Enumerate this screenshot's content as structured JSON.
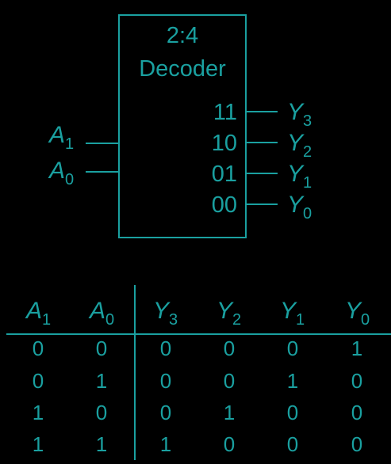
{
  "decoder": {
    "title_line1": "2:4",
    "title_line2": "Decoder",
    "inputs": [
      {
        "var": "A",
        "sub": "1"
      },
      {
        "var": "A",
        "sub": "0"
      }
    ],
    "outputs": [
      {
        "code": "11",
        "var": "Y",
        "sub": "3"
      },
      {
        "code": "10",
        "var": "Y",
        "sub": "2"
      },
      {
        "code": "01",
        "var": "Y",
        "sub": "1"
      },
      {
        "code": "00",
        "var": "Y",
        "sub": "0"
      }
    ]
  },
  "truth_table": {
    "headers": [
      {
        "var": "A",
        "sub": "1"
      },
      {
        "var": "A",
        "sub": "0"
      },
      {
        "var": "Y",
        "sub": "3"
      },
      {
        "var": "Y",
        "sub": "2"
      },
      {
        "var": "Y",
        "sub": "1"
      },
      {
        "var": "Y",
        "sub": "0"
      }
    ],
    "rows": [
      [
        "0",
        "0",
        "0",
        "0",
        "0",
        "1"
      ],
      [
        "0",
        "1",
        "0",
        "0",
        "1",
        "0"
      ],
      [
        "1",
        "0",
        "0",
        "1",
        "0",
        "0"
      ],
      [
        "1",
        "1",
        "1",
        "0",
        "0",
        "0"
      ]
    ]
  },
  "colors": {
    "background": "#000000",
    "foreground": "#1aa0a0"
  }
}
